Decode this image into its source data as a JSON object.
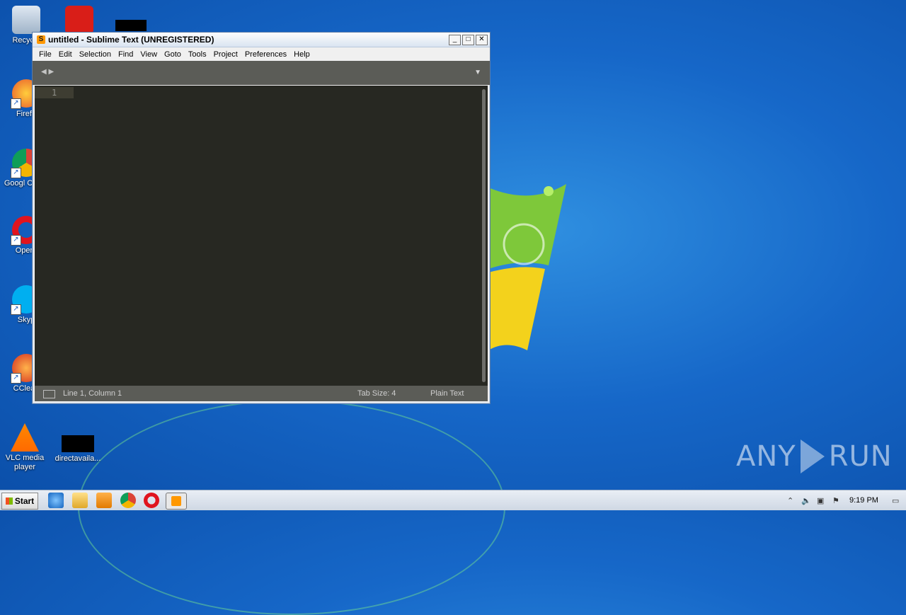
{
  "desktop": {
    "icons": [
      {
        "label": "Recycle",
        "icon": "recycle-bin-icon"
      },
      {
        "label": "Firefo",
        "icon": "firefox-icon"
      },
      {
        "label": "Googl Chron",
        "icon": "chrome-icon"
      },
      {
        "label": "Opera",
        "icon": "opera-icon"
      },
      {
        "label": "Skyp",
        "icon": "skype-icon"
      },
      {
        "label": "CClean",
        "icon": "ccleaner-icon"
      },
      {
        "label": "VLC media player",
        "icon": "vlc-icon"
      },
      {
        "label": "directavaila...",
        "icon": "black-file-icon"
      }
    ],
    "watermark": {
      "left": "ANY",
      "right": "RUN"
    }
  },
  "window": {
    "title": "untitled - Sublime Text (UNREGISTERED)",
    "controls": {
      "minimize": "_",
      "maximize": "□",
      "close": "✕"
    },
    "menu": [
      "File",
      "Edit",
      "Selection",
      "Find",
      "View",
      "Goto",
      "Tools",
      "Project",
      "Preferences",
      "Help"
    ],
    "tabbar": {
      "nav": "◀ ▶",
      "dropdown": "▼"
    },
    "editor": {
      "line_number": "1"
    },
    "status": {
      "position": "Line 1, Column 1",
      "tab_size": "Tab Size: 4",
      "syntax": "Plain Text"
    }
  },
  "taskbar": {
    "start_label": "Start",
    "apps": [
      "internet-explorer-icon",
      "explorer-icon",
      "media-player-icon",
      "chrome-icon",
      "opera-icon",
      "sublime-text-icon"
    ],
    "tray": {
      "clock": "9:19 PM"
    }
  },
  "colors": {
    "editor_bg": "#272822",
    "chrome_bg": "#5b5c57",
    "desktop_blue": "#1667c8",
    "sublime_orange": "#ff9800"
  }
}
